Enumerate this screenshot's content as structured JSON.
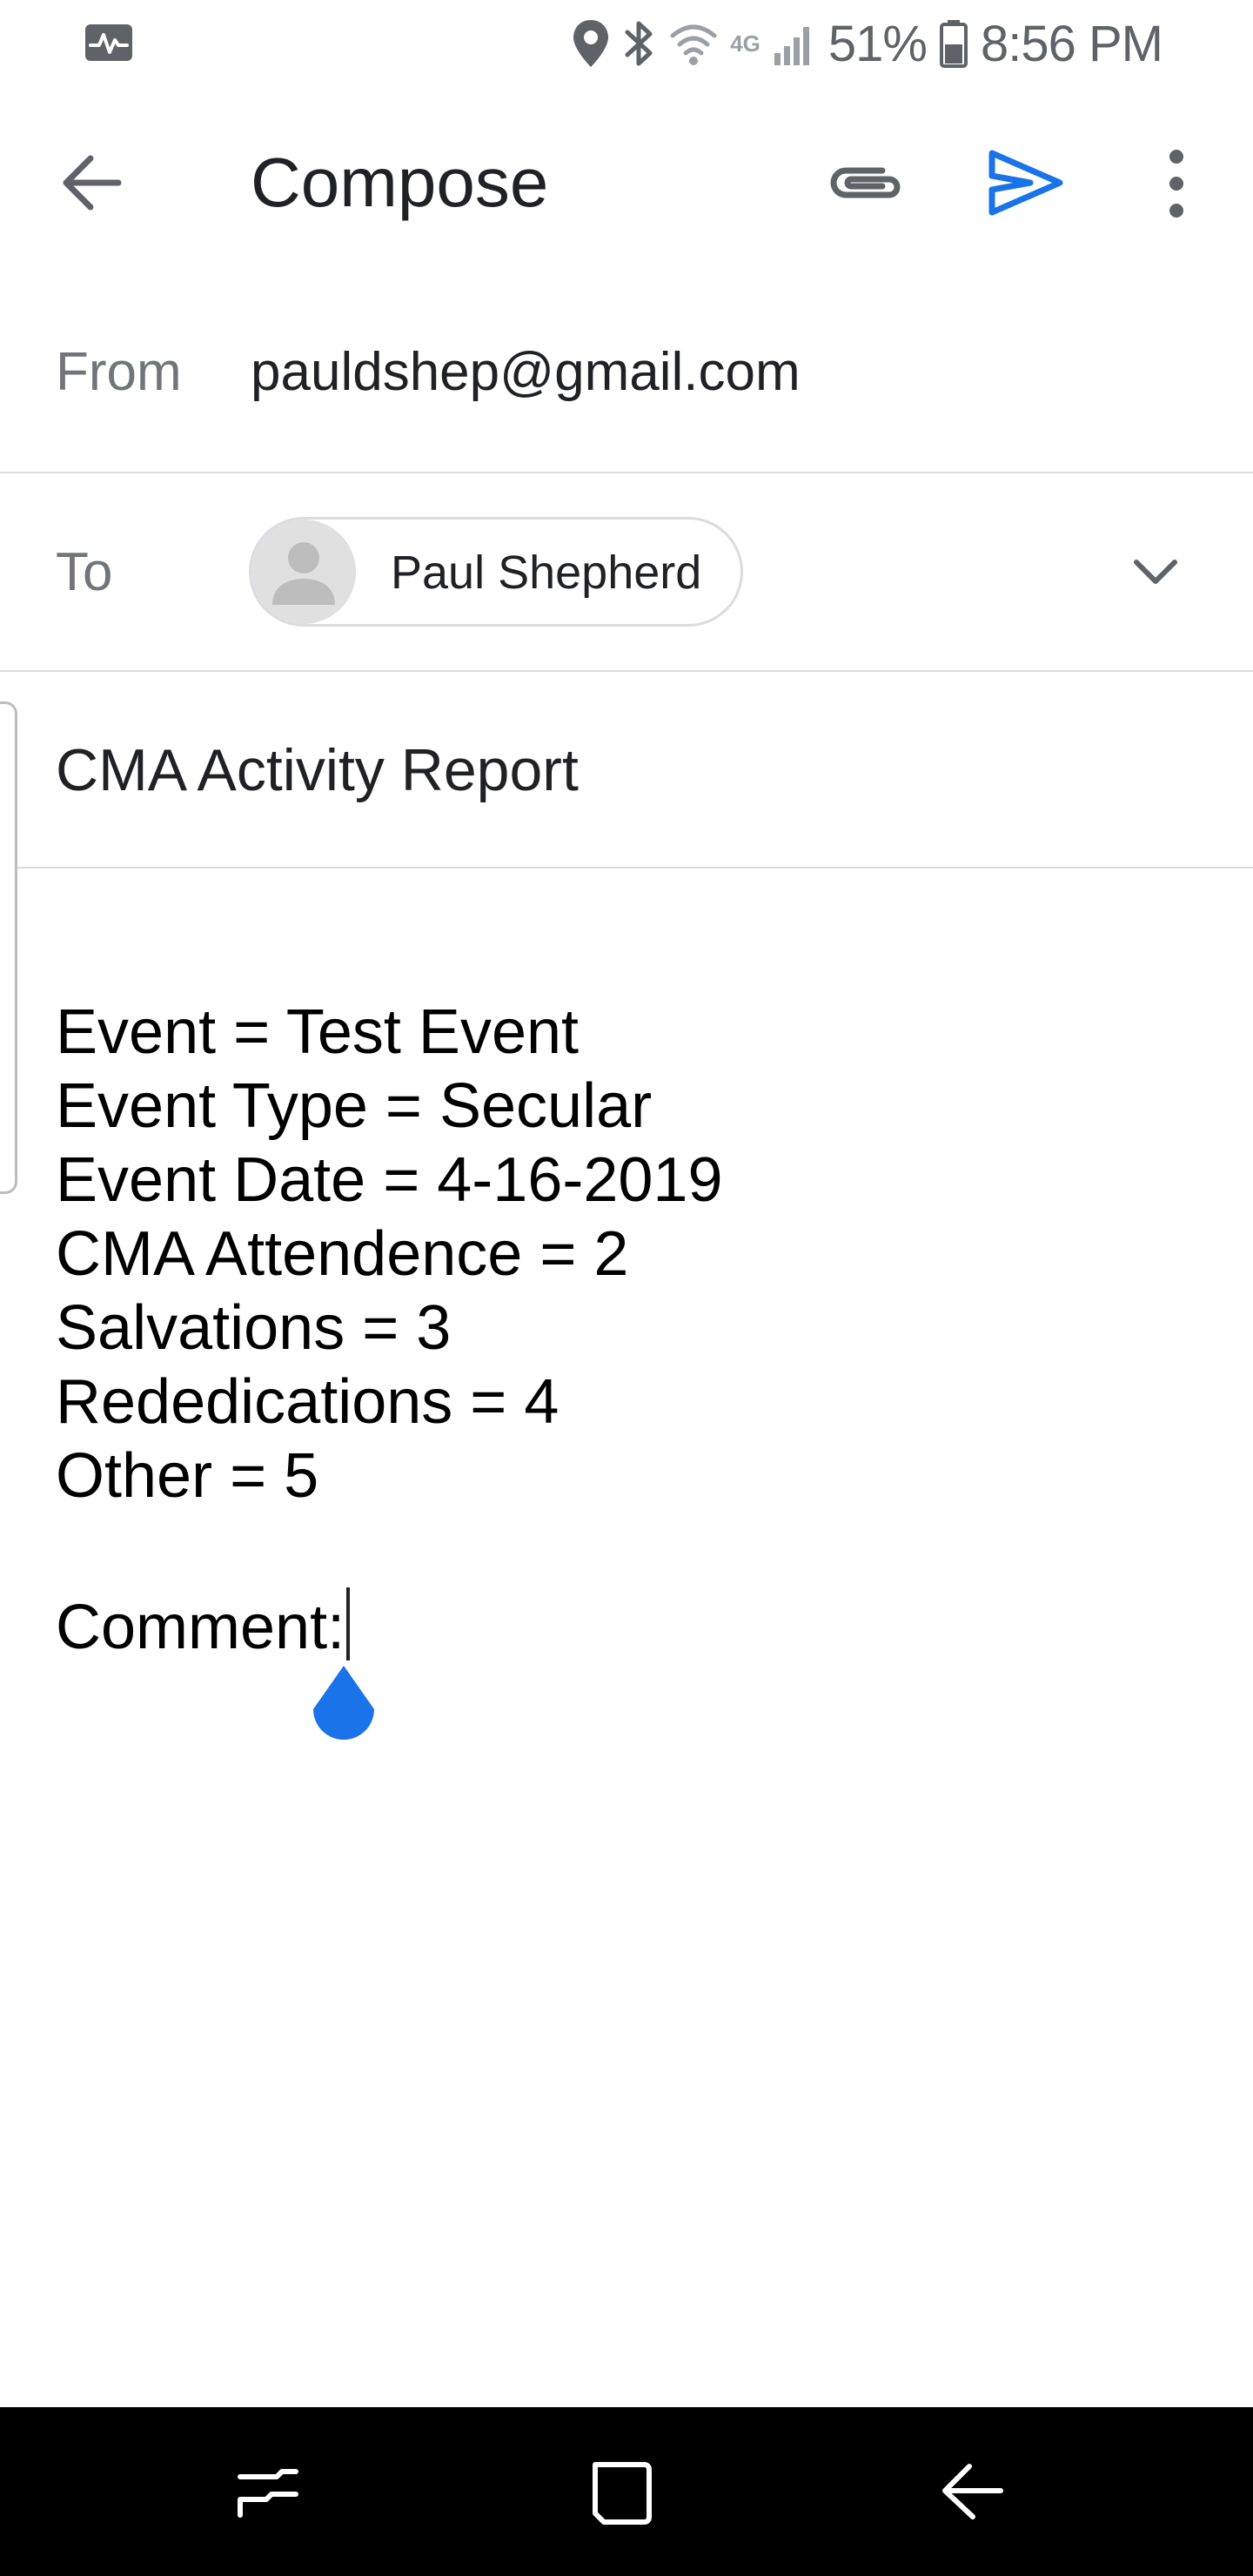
{
  "status_bar": {
    "network_label": "4G",
    "battery_percent": "51%",
    "time": "8:56 PM",
    "icons": [
      "activity-monitor-icon",
      "location-icon",
      "bluetooth-icon",
      "wifi-icon",
      "signal-icon",
      "battery-icon"
    ]
  },
  "app_bar": {
    "title": "Compose",
    "icons": [
      "back-arrow-icon",
      "paperclip-icon",
      "send-icon",
      "more-vertical-icon"
    ],
    "accent_color": "#1a73e8"
  },
  "from": {
    "label": "From",
    "value": "pauldshep@gmail.com"
  },
  "to": {
    "label": "To",
    "recipient_name": "Paul Shepherd",
    "icons": [
      "avatar-person-icon",
      "chevron-down-icon"
    ]
  },
  "subject": {
    "value": "CMA Activity Report"
  },
  "body": {
    "lines": [
      "Event = Test Event",
      "Event Type = Secular",
      "Event Date = 4-16-2019",
      "CMA Attendence = 2",
      "Salvations = 3",
      "Rededications = 4",
      "Other = 5"
    ],
    "comment_label": "Comment:"
  },
  "nav_bar": {
    "icons": [
      "recents-icon",
      "home-icon",
      "back-icon"
    ]
  }
}
